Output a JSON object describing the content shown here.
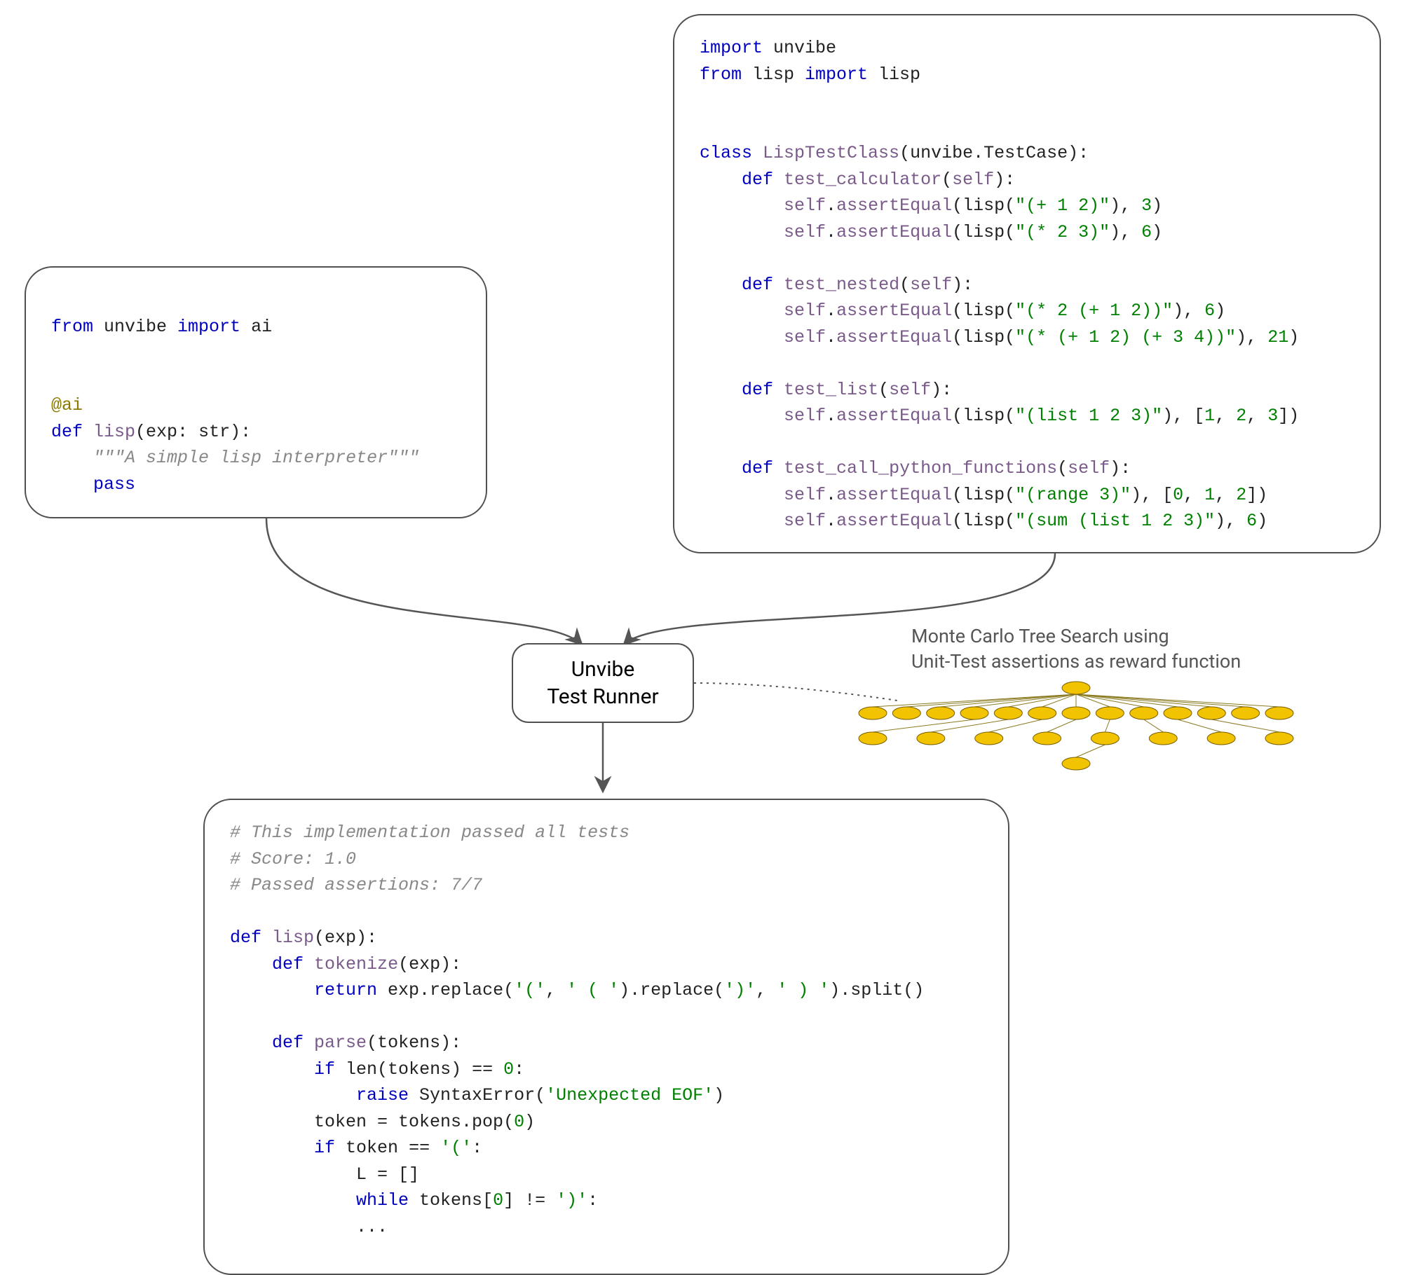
{
  "box_stub": {
    "lines": [
      [
        ""
      ],
      [
        {
          "c": "kw",
          "t": "from"
        },
        {
          "t": " unvibe "
        },
        {
          "c": "kw",
          "t": "import"
        },
        {
          "t": " ai"
        }
      ],
      [
        ""
      ],
      [
        ""
      ],
      [
        {
          "c": "dec",
          "t": "@ai"
        }
      ],
      [
        {
          "c": "kw",
          "t": "def"
        },
        {
          "t": " "
        },
        {
          "c": "fn",
          "t": "lisp"
        },
        {
          "t": "(exp: "
        },
        {
          "c": "id",
          "t": "str"
        },
        {
          "t": "):"
        }
      ],
      [
        {
          "t": "    "
        },
        {
          "c": "cm",
          "t": "\"\"\"A simple lisp interpreter\"\"\""
        }
      ],
      [
        {
          "t": "    "
        },
        {
          "c": "kw",
          "t": "pass"
        }
      ],
      [
        ""
      ]
    ]
  },
  "box_tests": {
    "lines": [
      [
        {
          "c": "kw",
          "t": "import"
        },
        {
          "t": " unvibe"
        }
      ],
      [
        {
          "c": "kw",
          "t": "from"
        },
        {
          "t": " lisp "
        },
        {
          "c": "kw",
          "t": "import"
        },
        {
          "t": " lisp"
        }
      ],
      [
        ""
      ],
      [
        ""
      ],
      [
        {
          "c": "kw",
          "t": "class"
        },
        {
          "t": " "
        },
        {
          "c": "fn",
          "t": "LispTestClass"
        },
        {
          "t": "(unvibe.TestCase):"
        }
      ],
      [
        {
          "t": "    "
        },
        {
          "c": "kw",
          "t": "def"
        },
        {
          "t": " "
        },
        {
          "c": "fn",
          "t": "test_calculator"
        },
        {
          "t": "("
        },
        {
          "c": "fn",
          "t": "self"
        },
        {
          "t": "):"
        }
      ],
      [
        {
          "t": "        "
        },
        {
          "c": "fn",
          "t": "self"
        },
        {
          "t": "."
        },
        {
          "c": "fn",
          "t": "assertEqual"
        },
        {
          "t": "(lisp("
        },
        {
          "c": "str",
          "t": "\"(+ 1 2)\""
        },
        {
          "t": "), "
        },
        {
          "c": "num",
          "t": "3"
        },
        {
          "t": ")"
        }
      ],
      [
        {
          "t": "        "
        },
        {
          "c": "fn",
          "t": "self"
        },
        {
          "t": "."
        },
        {
          "c": "fn",
          "t": "assertEqual"
        },
        {
          "t": "(lisp("
        },
        {
          "c": "str",
          "t": "\"(* 2 3)\""
        },
        {
          "t": "), "
        },
        {
          "c": "num",
          "t": "6"
        },
        {
          "t": ")"
        }
      ],
      [
        ""
      ],
      [
        {
          "t": "    "
        },
        {
          "c": "kw",
          "t": "def"
        },
        {
          "t": " "
        },
        {
          "c": "fn",
          "t": "test_nested"
        },
        {
          "t": "("
        },
        {
          "c": "fn",
          "t": "self"
        },
        {
          "t": "):"
        }
      ],
      [
        {
          "t": "        "
        },
        {
          "c": "fn",
          "t": "self"
        },
        {
          "t": "."
        },
        {
          "c": "fn",
          "t": "assertEqual"
        },
        {
          "t": "(lisp("
        },
        {
          "c": "str",
          "t": "\"(* 2 (+ 1 2))\""
        },
        {
          "t": "), "
        },
        {
          "c": "num",
          "t": "6"
        },
        {
          "t": ")"
        }
      ],
      [
        {
          "t": "        "
        },
        {
          "c": "fn",
          "t": "self"
        },
        {
          "t": "."
        },
        {
          "c": "fn",
          "t": "assertEqual"
        },
        {
          "t": "(lisp("
        },
        {
          "c": "str",
          "t": "\"(* (+ 1 2) (+ 3 4))\""
        },
        {
          "t": "), "
        },
        {
          "c": "num",
          "t": "21"
        },
        {
          "t": ")"
        }
      ],
      [
        ""
      ],
      [
        {
          "t": "    "
        },
        {
          "c": "kw",
          "t": "def"
        },
        {
          "t": " "
        },
        {
          "c": "fn",
          "t": "test_list"
        },
        {
          "t": "("
        },
        {
          "c": "fn",
          "t": "self"
        },
        {
          "t": "):"
        }
      ],
      [
        {
          "t": "        "
        },
        {
          "c": "fn",
          "t": "self"
        },
        {
          "t": "."
        },
        {
          "c": "fn",
          "t": "assertEqual"
        },
        {
          "t": "(lisp("
        },
        {
          "c": "str",
          "t": "\"(list 1 2 3)\""
        },
        {
          "t": "), ["
        },
        {
          "c": "num",
          "t": "1"
        },
        {
          "t": ", "
        },
        {
          "c": "num",
          "t": "2"
        },
        {
          "t": ", "
        },
        {
          "c": "num",
          "t": "3"
        },
        {
          "t": "])"
        }
      ],
      [
        ""
      ],
      [
        {
          "t": "    "
        },
        {
          "c": "kw",
          "t": "def"
        },
        {
          "t": " "
        },
        {
          "c": "fn",
          "t": "test_call_python_functions"
        },
        {
          "t": "("
        },
        {
          "c": "fn",
          "t": "self"
        },
        {
          "t": "):"
        }
      ],
      [
        {
          "t": "        "
        },
        {
          "c": "fn",
          "t": "self"
        },
        {
          "t": "."
        },
        {
          "c": "fn",
          "t": "assertEqual"
        },
        {
          "t": "(lisp("
        },
        {
          "c": "str",
          "t": "\"(range 3)\""
        },
        {
          "t": "), ["
        },
        {
          "c": "num",
          "t": "0"
        },
        {
          "t": ", "
        },
        {
          "c": "num",
          "t": "1"
        },
        {
          "t": ", "
        },
        {
          "c": "num",
          "t": "2"
        },
        {
          "t": "])"
        }
      ],
      [
        {
          "t": "        "
        },
        {
          "c": "fn",
          "t": "self"
        },
        {
          "t": "."
        },
        {
          "c": "fn",
          "t": "assertEqual"
        },
        {
          "t": "(lisp("
        },
        {
          "c": "str",
          "t": "\"(sum (list 1 2 3)\""
        },
        {
          "t": "), "
        },
        {
          "c": "num",
          "t": "6"
        },
        {
          "t": ")"
        }
      ]
    ]
  },
  "runner": {
    "line1": "Unvibe",
    "line2": "Test Runner"
  },
  "caption": {
    "line1": "Monte Carlo Tree Search using",
    "line2": "Unit-Test assertions as reward function"
  },
  "box_output": {
    "lines": [
      [
        {
          "c": "cm",
          "t": "# This implementation passed all tests"
        }
      ],
      [
        {
          "c": "cm",
          "t": "# Score: 1.0"
        }
      ],
      [
        {
          "c": "cm",
          "t": "# Passed assertions: 7/7"
        }
      ],
      [
        ""
      ],
      [
        {
          "c": "kw",
          "t": "def"
        },
        {
          "t": " "
        },
        {
          "c": "fn",
          "t": "lisp"
        },
        {
          "t": "(exp):"
        }
      ],
      [
        {
          "t": "    "
        },
        {
          "c": "kw",
          "t": "def"
        },
        {
          "t": " "
        },
        {
          "c": "fn",
          "t": "tokenize"
        },
        {
          "t": "(exp):"
        }
      ],
      [
        {
          "t": "        "
        },
        {
          "c": "kw",
          "t": "return"
        },
        {
          "t": " exp.replace("
        },
        {
          "c": "str",
          "t": "'('"
        },
        {
          "t": ", "
        },
        {
          "c": "str",
          "t": "' ( '"
        },
        {
          "t": ").replace("
        },
        {
          "c": "str",
          "t": "')'"
        },
        {
          "t": ", "
        },
        {
          "c": "str",
          "t": "' ) '"
        },
        {
          "t": ").split()"
        }
      ],
      [
        ""
      ],
      [
        {
          "t": "    "
        },
        {
          "c": "kw",
          "t": "def"
        },
        {
          "t": " "
        },
        {
          "c": "fn",
          "t": "parse"
        },
        {
          "t": "(tokens):"
        }
      ],
      [
        {
          "t": "        "
        },
        {
          "c": "kw",
          "t": "if"
        },
        {
          "t": " len(tokens) == "
        },
        {
          "c": "num",
          "t": "0"
        },
        {
          "t": ":"
        }
      ],
      [
        {
          "t": "            "
        },
        {
          "c": "kw",
          "t": "raise"
        },
        {
          "t": " SyntaxError("
        },
        {
          "c": "str",
          "t": "'Unexpected EOF'"
        },
        {
          "t": ")"
        }
      ],
      [
        {
          "t": "        token = tokens.pop("
        },
        {
          "c": "num",
          "t": "0"
        },
        {
          "t": ")"
        }
      ],
      [
        {
          "t": "        "
        },
        {
          "c": "kw",
          "t": "if"
        },
        {
          "t": " token == "
        },
        {
          "c": "str",
          "t": "'('"
        },
        {
          "t": ":"
        }
      ],
      [
        {
          "t": "            L = []"
        }
      ],
      [
        {
          "t": "            "
        },
        {
          "c": "kw",
          "t": "while"
        },
        {
          "t": " tokens["
        },
        {
          "c": "num",
          "t": "0"
        },
        {
          "t": "] != "
        },
        {
          "c": "str",
          "t": "')'"
        },
        {
          "t": ":"
        }
      ],
      [
        {
          "t": "            ..."
        }
      ]
    ]
  },
  "mcts": {
    "rows": [
      1,
      13,
      8,
      1
    ]
  }
}
